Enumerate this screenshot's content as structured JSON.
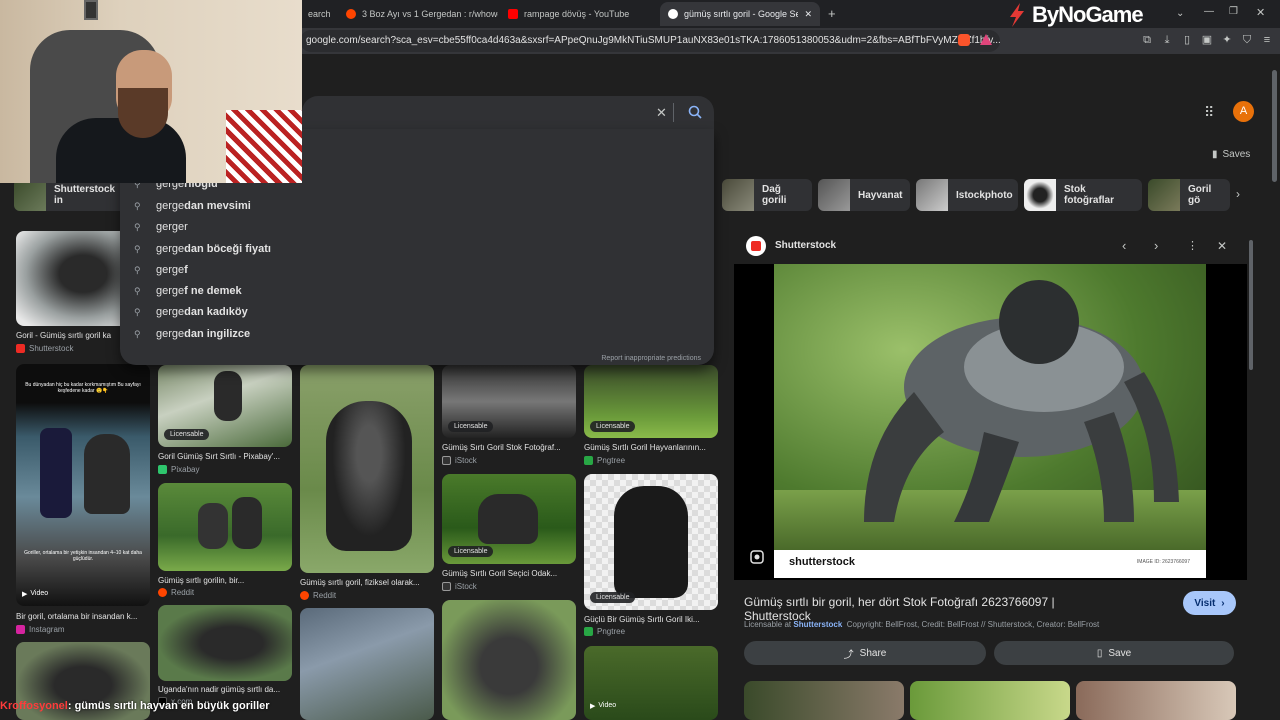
{
  "browser": {
    "tabs": [
      {
        "label": "earch",
        "color": "#8ab4f8"
      },
      {
        "label": "3 Boz Ayı vs 1 Gergedan : r/whowoul",
        "color": "#ff4500"
      },
      {
        "label": "rampage dövüş - YouTube",
        "color": "#ff0000"
      },
      {
        "label": "gümüş sırtlı goril - Google Searc",
        "color": "#8ab4f8"
      }
    ],
    "close_tab": "✕",
    "new_tab": "+",
    "url": "google.com/search?sca_esv=cbe55ff0ca4d463a&sxsrf=APpeQnuJg9MkNTiuSMUP1auNX83e01sTKA:1786051380053&udm=2&fbs=ABfTbFVyMZGZf1hfv...",
    "watermark": "ByNoGame"
  },
  "google": {
    "avatar_letter": "A",
    "saves_label": "Saves",
    "report_predictions": "Report inappropriate predictions",
    "suggestions": [
      {
        "prefix": "gerge",
        "rest": "rlioğlu"
      },
      {
        "prefix": "gerge",
        "rest": "dan mevsimi"
      },
      {
        "prefix": "gerger",
        "rest": ""
      },
      {
        "prefix": "gerge",
        "rest": "dan böceği fiyatı"
      },
      {
        "prefix": "gerge",
        "rest": "f"
      },
      {
        "prefix": "gerge",
        "rest": "f ne demek"
      },
      {
        "prefix": "gerge",
        "rest": "dan kadıköy"
      },
      {
        "prefix": "gerge",
        "rest": "dan ingilizce"
      }
    ],
    "chips": [
      {
        "label": "Shutterstock in"
      },
      {
        "label": "Dağ gorili"
      },
      {
        "label": "Hayvanat"
      },
      {
        "label": "Istockphoto"
      },
      {
        "label": "Stok fotoğraflar"
      },
      {
        "label": "Goril gö"
      }
    ],
    "results": [
      {
        "caption": "Goril - Gümüş sırtlı goril ka",
        "source": "Shutterstock",
        "src_color": "#ee2b24"
      },
      {
        "caption": "Bir goril, ortalama bir insandan k...",
        "source": "Instagram",
        "src_color": "#d6249f"
      },
      {
        "caption": "Goril Gümüş Sırt Sırtlı - Pixabay'...",
        "source": "Pixabay",
        "src_color": "#2ec66d"
      },
      {
        "caption": "Gümüş sırtlı gorilin, bir...",
        "source": "Reddit",
        "src_color": "#ff4500"
      },
      {
        "caption": "Uganda'nın nadir gümüş sırtlı da...",
        "source": "x.com",
        "src_color": "#000000"
      },
      {
        "caption": "Gümüş sırtlı goril, fiziksel olarak...",
        "source": "Reddit",
        "src_color": "#ff4500"
      },
      {
        "caption": "Gümüş Sırtı Goril Stok Fotoğraf...",
        "source": "iStock",
        "src_color": "#333333"
      },
      {
        "caption": "Gümüş Sırtlı Goril Seçici Odak...",
        "source": "iStock",
        "src_color": "#333333"
      },
      {
        "caption": "Gümüş Sırtlı Goril Hayvanlarının...",
        "source": "Pngtree",
        "src_color": "#28a745"
      },
      {
        "caption": "Güçlü Bir Gümüş Sırtlı Goril Iki...",
        "source": "Pngtree",
        "src_color": "#28a745"
      }
    ],
    "badge_licensable": "Licensable",
    "badge_video": "Video",
    "overlay_text_1": "Bu dünyadan hiç bu kadar korkmamıştım Bu sayfayı keşfedene kadar 😲👇",
    "overlay_text_2": "Goriller, ortalama bir yetişkin insandan 4–10 kat daha güçlüdür.",
    "panel": {
      "source_name": "Shutterstock",
      "title": "Gümüş sırtlı bir goril, her dört Stok Fotoğrafı 2623766097 | Shutterstock",
      "visit_label": "Visit",
      "licensable_prefix": "Licensable at",
      "licensable_link": "Shutterstock",
      "credits": "Copyright: BellFrost, Credit: BellFrost // Shutterstock, Creator: BellFrost",
      "share_label": "Share",
      "save_label": "Save",
      "watermark": "shutterstock",
      "image_id": "IMAGE ID: 2623766097"
    }
  },
  "stream": {
    "chat_user": "Kroffosyonel",
    "chat_message": ": gümüs sırtlı hayvan en büyük goriller"
  },
  "colors": {
    "accent": "#8ab4f8",
    "avatar": "#e8710a",
    "visit_bg": "#a8c7fa"
  }
}
